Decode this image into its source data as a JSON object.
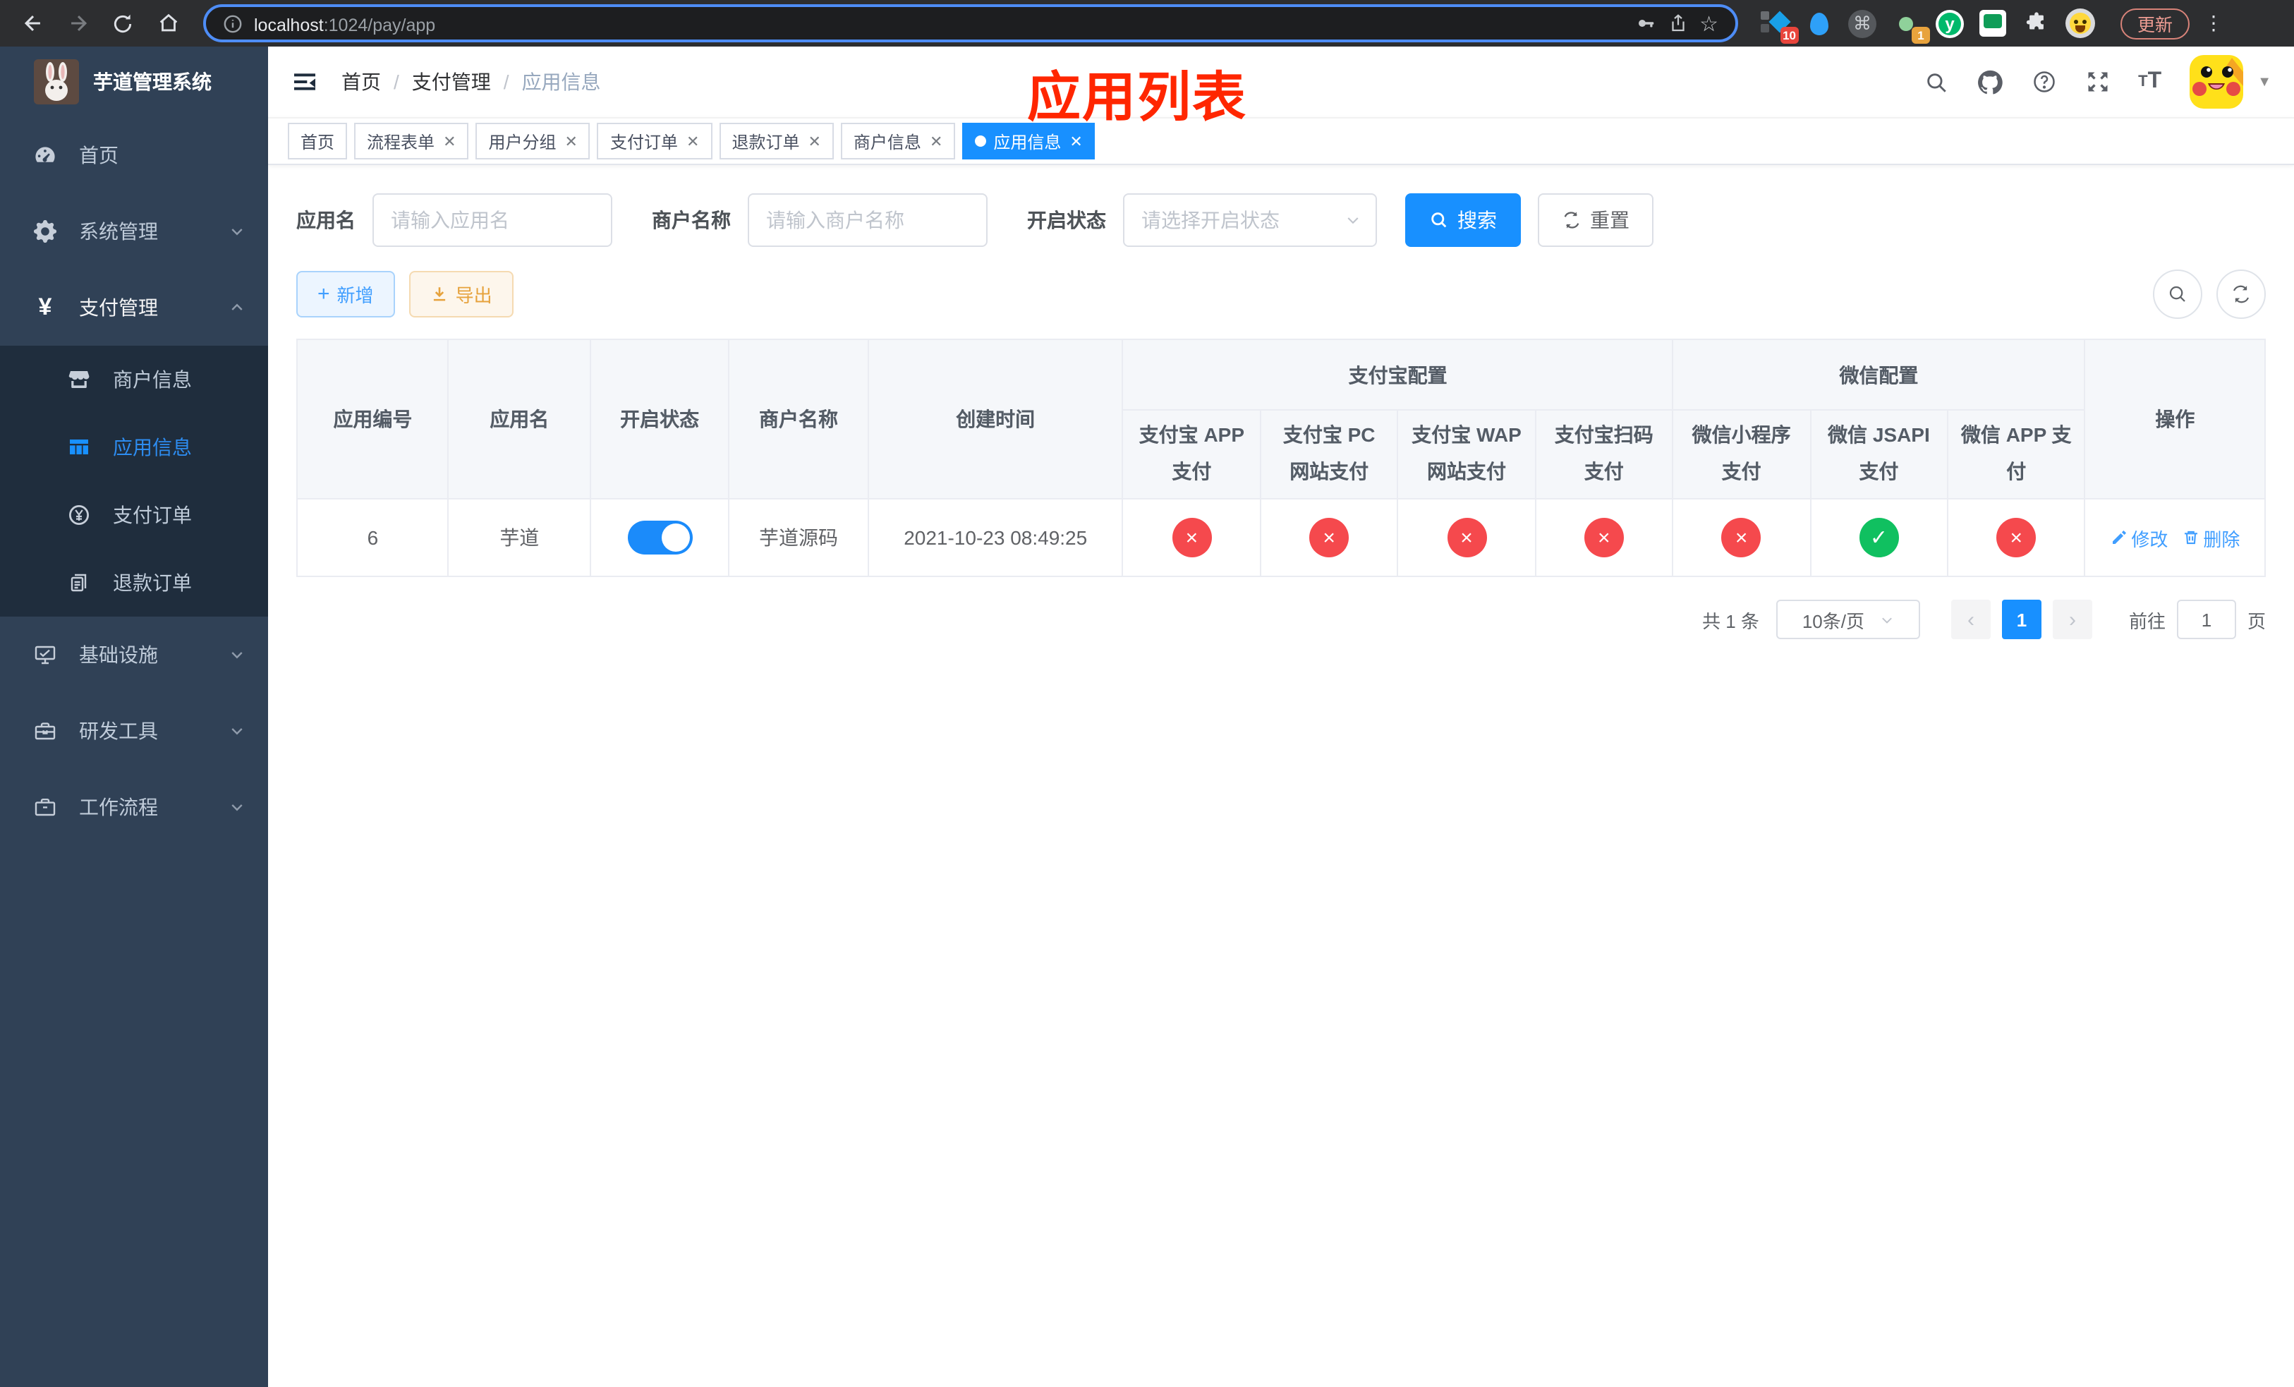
{
  "browser": {
    "url": {
      "host": "localhost",
      "rest": ":1024/pay/app"
    },
    "update_label": "更新",
    "ext_badges": {
      "first": "10",
      "profile": "1"
    }
  },
  "sidebar": {
    "title": "芋道管理系统",
    "menu": [
      {
        "label": "首页"
      },
      {
        "label": "系统管理"
      },
      {
        "label": "支付管理"
      },
      {
        "label": "商户信息"
      },
      {
        "label": "应用信息"
      },
      {
        "label": "支付订单"
      },
      {
        "label": "退款订单"
      },
      {
        "label": "基础设施"
      },
      {
        "label": "研发工具"
      },
      {
        "label": "工作流程"
      }
    ]
  },
  "breadcrumb": {
    "items": [
      "首页",
      "支付管理",
      "应用信息"
    ]
  },
  "annotation": {
    "title": "应用列表"
  },
  "tags": [
    {
      "label": "首页"
    },
    {
      "label": "流程表单"
    },
    {
      "label": "用户分组"
    },
    {
      "label": "支付订单"
    },
    {
      "label": "退款订单"
    },
    {
      "label": "商户信息"
    },
    {
      "label": "应用信息"
    }
  ],
  "search": {
    "app_name_label": "应用名",
    "app_name_placeholder": "请输入应用名",
    "merchant_label": "商户名称",
    "merchant_placeholder": "请输入商户名称",
    "status_label": "开启状态",
    "status_placeholder": "请选择开启状态",
    "search_label": "搜索",
    "reset_label": "重置"
  },
  "toolbar": {
    "add_label": "新增",
    "export_label": "导出"
  },
  "table": {
    "headers": {
      "app_id": "应用编号",
      "app_name": "应用名",
      "status": "开启状态",
      "merchant": "商户名称",
      "created": "创建时间",
      "alipay_group": "支付宝配置",
      "wechat_group": "微信配置",
      "ops": "操作",
      "sub": [
        "支付宝 APP 支付",
        "支付宝 PC 网站支付",
        "支付宝 WAP 网站支付",
        "支付宝扫码支付",
        "微信小程序支付",
        "微信 JSAPI 支付",
        "微信 APP 支付"
      ]
    },
    "row": {
      "app_id": "6",
      "app_name": "芋道",
      "status_on": true,
      "merchant": "芋道源码",
      "created": "2021-10-23 08:49:25",
      "configs": [
        false,
        false,
        false,
        false,
        false,
        true,
        false
      ],
      "edit_label": "修改",
      "delete_label": "删除"
    }
  },
  "pagination": {
    "total": "共 1 条",
    "page_size": "10条/页",
    "page": "1",
    "goto_prefix": "前往",
    "goto_value": "1",
    "goto_suffix": "页"
  },
  "colors": {
    "accent": "#1890ff",
    "link": "#409EFF",
    "danger": "#f5494d",
    "success": "#10c060",
    "annotation": "#ff2600"
  }
}
